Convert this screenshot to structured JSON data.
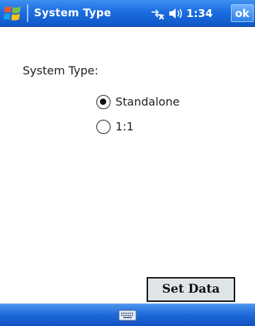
{
  "titlebar": {
    "title": "System Type",
    "time": "1:34",
    "ok_label": "ok"
  },
  "form": {
    "field_label": "System Type:",
    "options": [
      {
        "label": "Standalone",
        "selected": true
      },
      {
        "label": "1:1",
        "selected": false
      }
    ],
    "set_data_label": "Set Data"
  },
  "icons": {
    "start": "windows-flag-icon",
    "connectivity": "connectivity-icon",
    "volume": "volume-icon",
    "sip": "keyboard-icon"
  },
  "colors": {
    "titlebar": "#1c6ee0",
    "menubar": "#1d68d8",
    "button_face": "#dfe4e6",
    "text": "#202020"
  }
}
